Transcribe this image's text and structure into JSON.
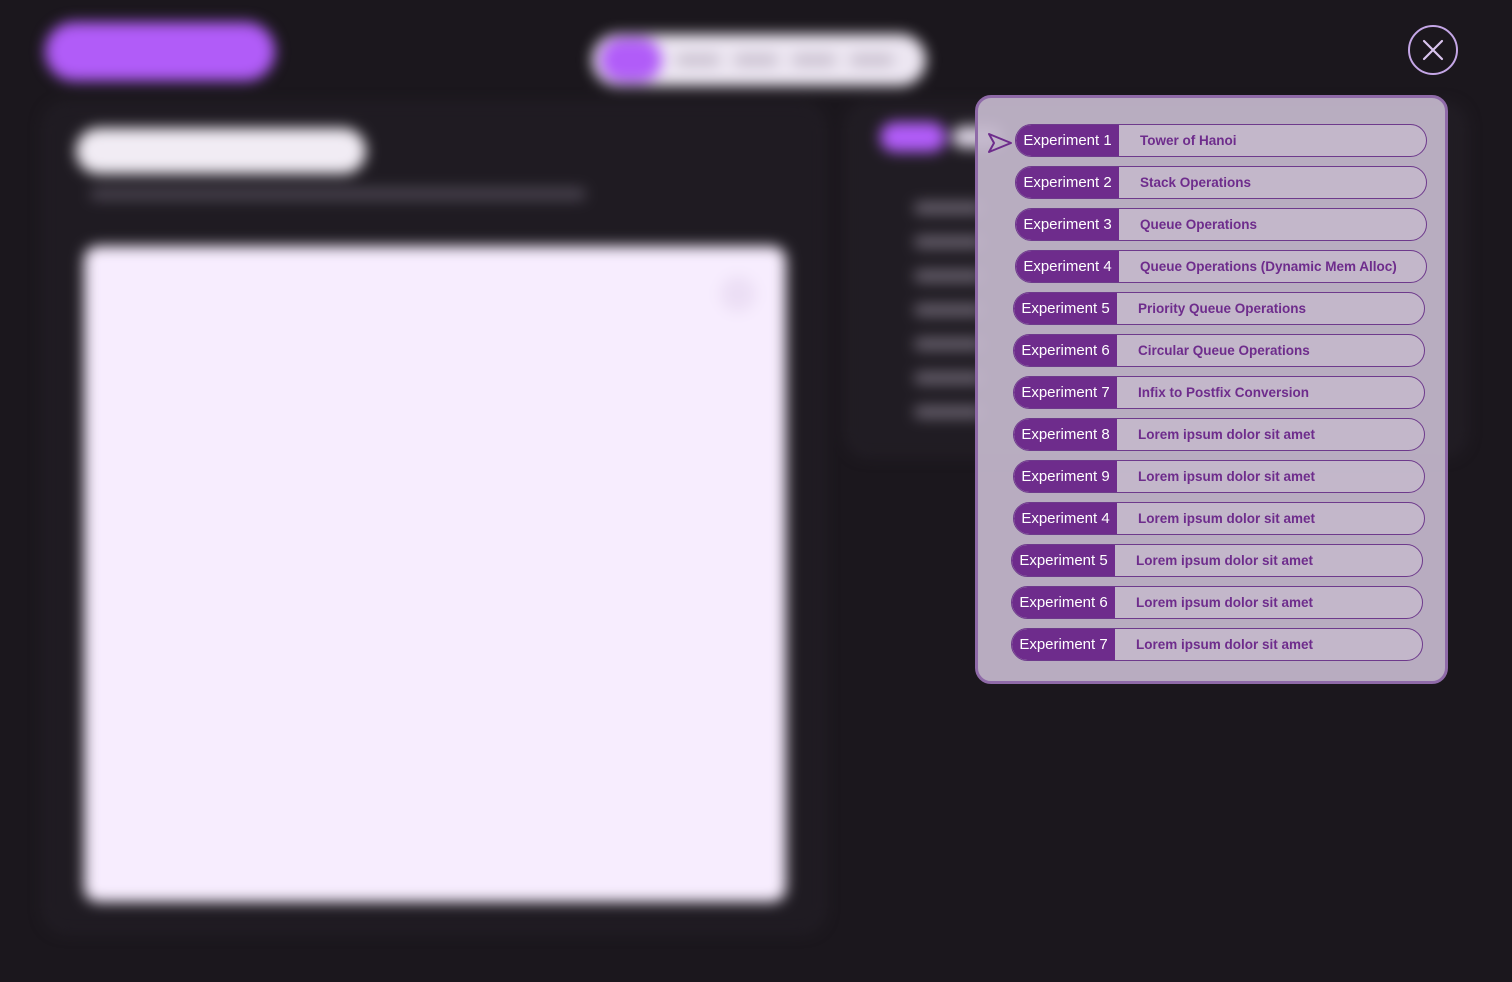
{
  "picker": {
    "experiments": [
      {
        "badge": "Experiment 1",
        "title": "Tower of Hanoi",
        "selected": true
      },
      {
        "badge": "Experiment 2",
        "title": "Stack Operations"
      },
      {
        "badge": "Experiment 3",
        "title": "Queue Operations"
      },
      {
        "badge": "Experiment 4",
        "title": "Queue Operations (Dynamic Mem Alloc)"
      },
      {
        "badge": "Experiment 5",
        "title": "Priority Queue Operations"
      },
      {
        "badge": "Experiment 6",
        "title": "Circular Queue Operations"
      },
      {
        "badge": "Experiment 7",
        "title": "Infix to Postfix Conversion"
      },
      {
        "badge": "Experiment 8",
        "title": "Lorem ipsum dolor sit amet"
      },
      {
        "badge": "Experiment 9",
        "title": "Lorem ipsum dolor sit amet"
      },
      {
        "badge": "Experiment 4",
        "title": "Lorem ipsum dolor sit amet"
      },
      {
        "badge": "Experiment 5",
        "title": "Lorem ipsum dolor sit amet"
      },
      {
        "badge": "Experiment 6",
        "title": "Lorem ipsum dolor sit amet"
      },
      {
        "badge": "Experiment 7",
        "title": "Lorem ipsum dolor sit amet"
      }
    ]
  },
  "icons": {
    "close": "close-icon",
    "selection_pointer": "pointer-arrow-icon"
  },
  "colors": {
    "background": "#1b171d",
    "accent": "#b15cf8",
    "badge": "#6e2c8c",
    "popup_border": "#8f6aa8",
    "close_ring": "#c4a6e6"
  }
}
